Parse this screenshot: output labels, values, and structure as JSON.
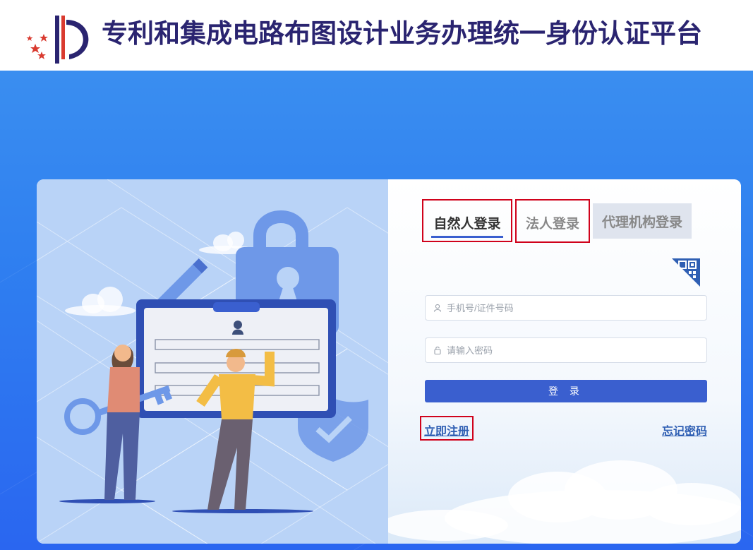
{
  "header": {
    "title": "专利和集成电路布图设计业务办理统一身份认证平台",
    "logo_icon": "cnipa-logo-icon"
  },
  "login": {
    "tabs": [
      {
        "label": "自然人登录",
        "active": true
      },
      {
        "label": "法人登录",
        "active": false
      },
      {
        "label": "代理机构登录",
        "active": false
      }
    ],
    "qr_icon": "qr-code-icon",
    "account": {
      "placeholder": "手机号/证件号码",
      "value": ""
    },
    "password": {
      "placeholder": "请输入密码",
      "value": ""
    },
    "submit_label": "登 录",
    "register_label": "立即注册",
    "forgot_label": "忘记密码"
  },
  "colors": {
    "brand_navy": "#2a2470",
    "primary_button": "#3a5fcf",
    "background_blue": "#2f7ff0",
    "highlight_red": "#d0021b"
  }
}
